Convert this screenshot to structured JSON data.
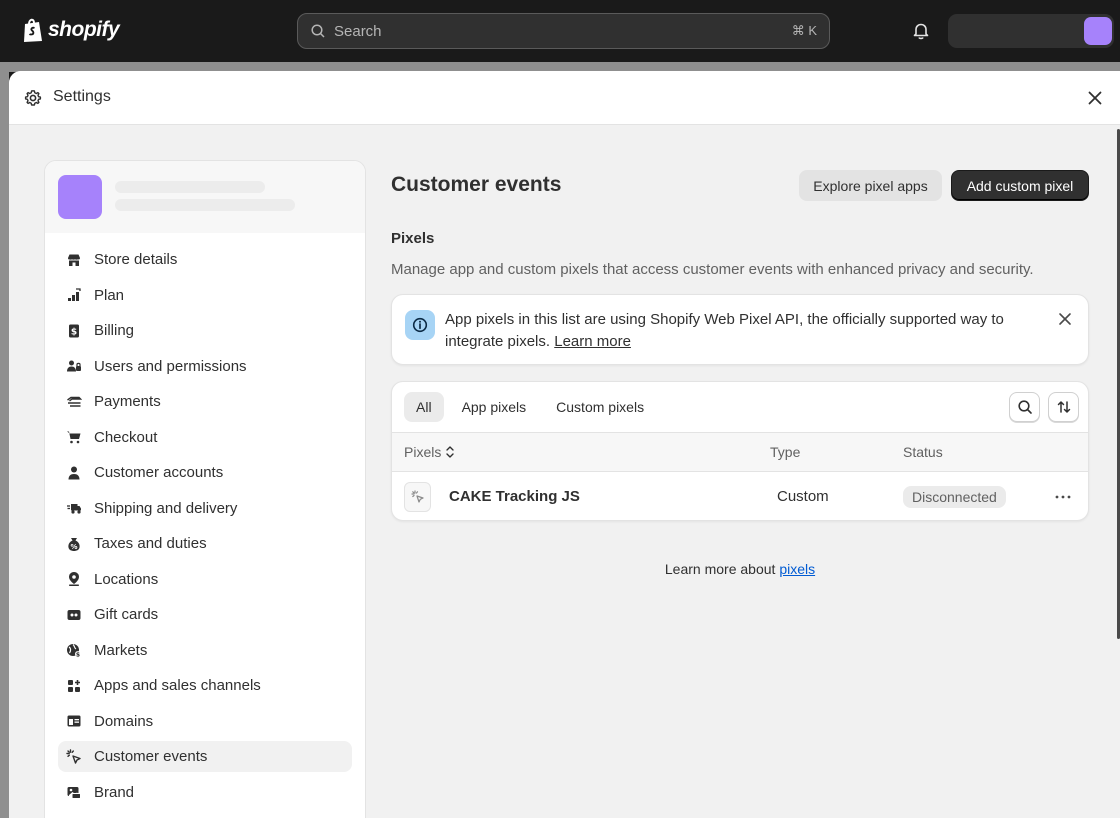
{
  "topbar": {
    "logo_text": "shopify",
    "search_placeholder": "Search",
    "search_shortcut": "⌘ K"
  },
  "modal": {
    "title": "Settings"
  },
  "sidebar": {
    "items": [
      {
        "label": "Store details",
        "icon": "store-icon"
      },
      {
        "label": "Plan",
        "icon": "plan-icon"
      },
      {
        "label": "Billing",
        "icon": "billing-icon"
      },
      {
        "label": "Users and permissions",
        "icon": "users-icon"
      },
      {
        "label": "Payments",
        "icon": "payments-icon"
      },
      {
        "label": "Checkout",
        "icon": "cart-icon"
      },
      {
        "label": "Customer accounts",
        "icon": "person-icon"
      },
      {
        "label": "Shipping and delivery",
        "icon": "truck-icon"
      },
      {
        "label": "Taxes and duties",
        "icon": "tax-icon"
      },
      {
        "label": "Locations",
        "icon": "location-icon"
      },
      {
        "label": "Gift cards",
        "icon": "gift-card-icon"
      },
      {
        "label": "Markets",
        "icon": "globe-icon"
      },
      {
        "label": "Apps and sales channels",
        "icon": "apps-icon"
      },
      {
        "label": "Domains",
        "icon": "domains-icon"
      },
      {
        "label": "Customer events",
        "icon": "cursor-click-icon",
        "active": true
      },
      {
        "label": "Brand",
        "icon": "brand-icon"
      }
    ]
  },
  "main": {
    "title": "Customer events",
    "explore_button": "Explore pixel apps",
    "add_button": "Add custom pixel",
    "section_title": "Pixels",
    "section_description": "Manage app and custom pixels that access customer events with enhanced privacy and security.",
    "banner": {
      "text": "App pixels in this list are using Shopify Web Pixel API, the officially supported way to integrate pixels.",
      "link": "Learn more"
    },
    "tabs": [
      "All",
      "App pixels",
      "Custom pixels"
    ],
    "table": {
      "columns": [
        "Pixels",
        "Type",
        "Status"
      ],
      "rows": [
        {
          "name": "CAKE Tracking JS",
          "type": "Custom",
          "status": "Disconnected"
        }
      ]
    },
    "footer_text": "Learn more about",
    "footer_link": "pixels"
  },
  "colors": {
    "accent_avatar": "#a682fb",
    "link": "#005bd3",
    "primary_button": "#303030"
  }
}
